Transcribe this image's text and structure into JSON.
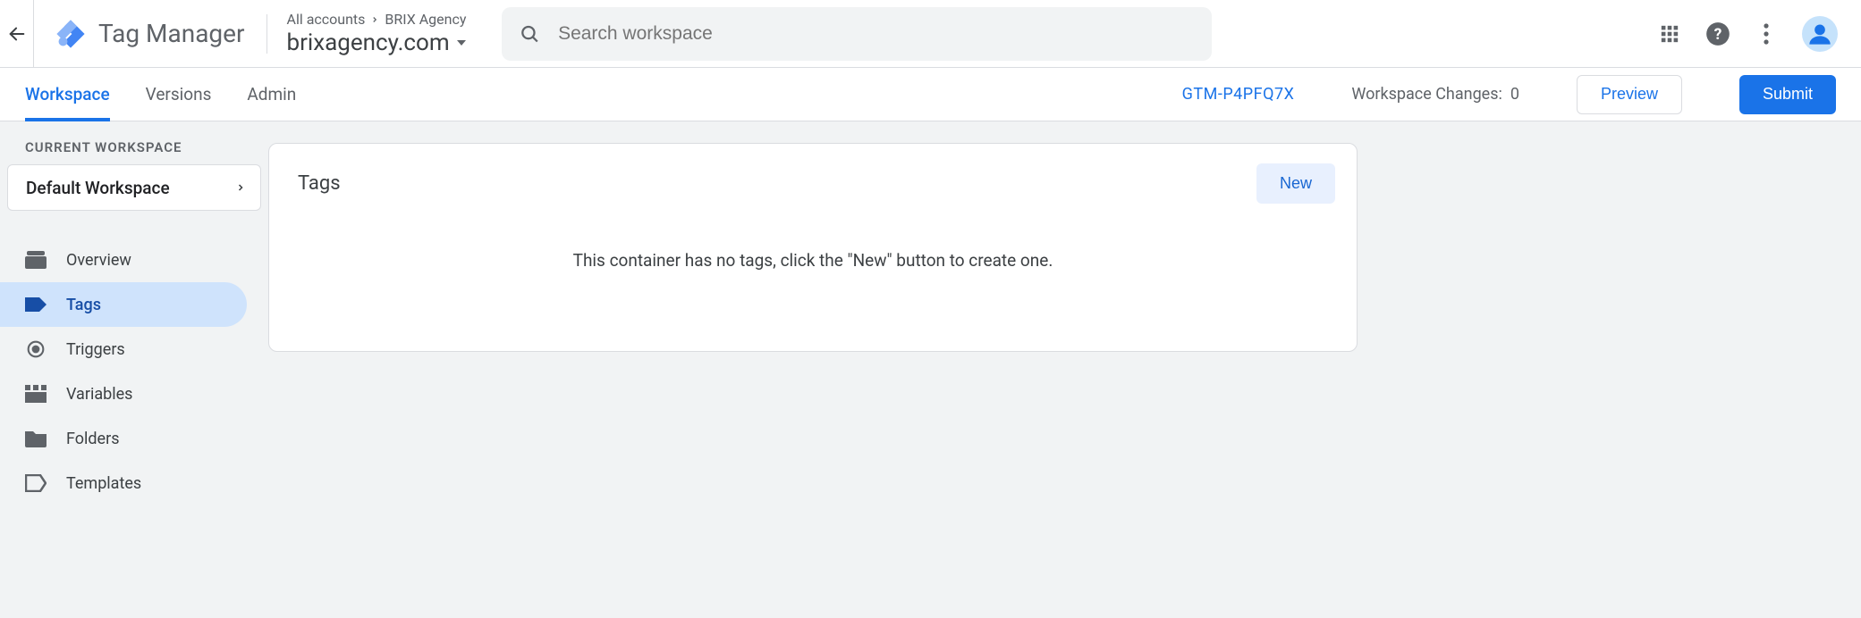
{
  "header": {
    "app_title": "Tag Manager",
    "breadcrumb_root": "All accounts",
    "breadcrumb_account": "BRIX Agency",
    "container_name": "brixagency.com",
    "search_placeholder": "Search workspace"
  },
  "tabs": {
    "workspace": "Workspace",
    "versions": "Versions",
    "admin": "Admin"
  },
  "toolbar": {
    "container_id": "GTM-P4PFQ7X",
    "ws_changes_label": "Workspace Changes:",
    "ws_changes_count": "0",
    "preview": "Preview",
    "submit": "Submit"
  },
  "sidebar": {
    "current_ws_label": "CURRENT WORKSPACE",
    "current_ws_name": "Default Workspace",
    "nav": {
      "overview": "Overview",
      "tags": "Tags",
      "triggers": "Triggers",
      "variables": "Variables",
      "folders": "Folders",
      "templates": "Templates"
    }
  },
  "main": {
    "card_title": "Tags",
    "new_button": "New",
    "empty_message": "This container has no tags, click the \"New\" button to create one."
  }
}
